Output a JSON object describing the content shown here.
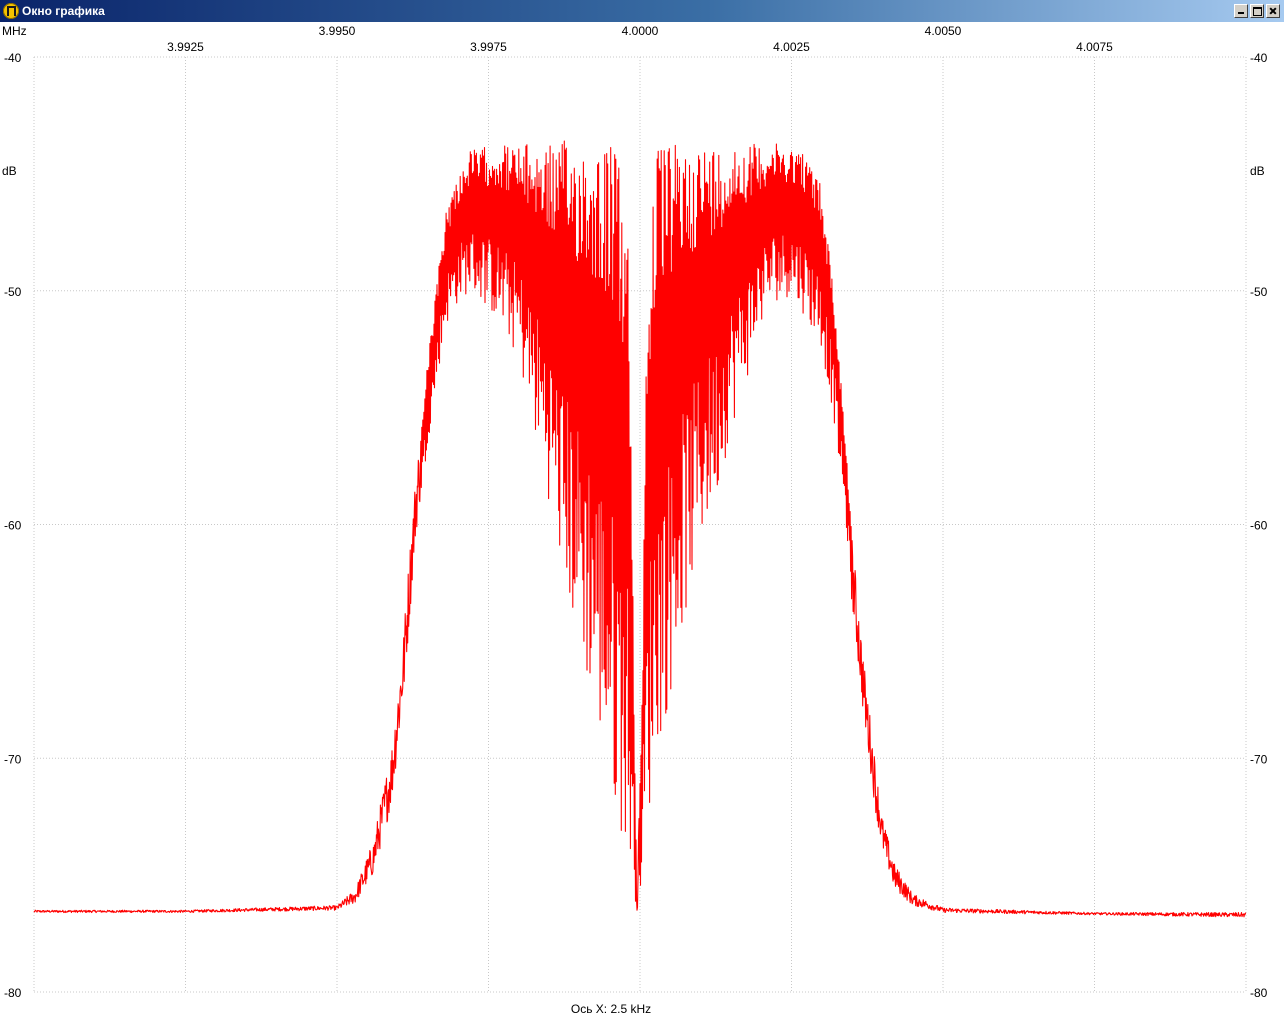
{
  "window": {
    "title": "Окно графика",
    "controls": [
      "minimize",
      "maximize",
      "close"
    ]
  },
  "colors": {
    "trace": "#ff0000",
    "grid": "#c8c8c8",
    "background": "#ffffff",
    "titlebar_start": "#0a246a",
    "titlebar_end": "#a6caf0"
  },
  "chart_data": {
    "type": "line",
    "title": "",
    "x_unit": "MHz",
    "y_unit": "dB",
    "xlim": [
      3.99,
      4.01
    ],
    "ylim": [
      -80,
      -40
    ],
    "x_ticks": [
      3.9925,
      3.995,
      3.9975,
      4.0,
      4.0025,
      4.005,
      4.0075
    ],
    "x_tick_labels_upper": [
      "3.9950",
      "4.0000",
      "4.0050"
    ],
    "x_tick_labels_lower": [
      "3.9925",
      "3.9975",
      "4.0025",
      "4.0075"
    ],
    "y_ticks": [
      -40,
      -50,
      -60,
      -70,
      -80
    ],
    "y_tick_labels": [
      "-40",
      "-50",
      "-60",
      "-70",
      "-80"
    ],
    "xlabel": "Ось X: 2.5 kHz",
    "grid": true,
    "series": [
      {
        "color": "#ff0000",
        "x": [
          3.99,
          3.9925,
          3.995,
          3.9953,
          3.9956,
          3.9959,
          3.9961,
          3.9962,
          3.9963,
          3.9965,
          3.9967,
          3.9968,
          3.997,
          3.9972,
          3.9975,
          3.9977,
          3.998,
          3.9982,
          3.9985,
          3.9987,
          3.999,
          3.9992,
          3.9994,
          3.9996,
          3.9998,
          3.99985,
          3.99995,
          4.00005,
          4.0001,
          4.0002,
          4.0003,
          4.0005,
          4.0007,
          4.001,
          4.0013,
          4.0015,
          4.0018,
          4.002,
          4.0022,
          4.0025,
          4.0027,
          4.003,
          4.0032,
          4.0034,
          4.0035,
          4.0037,
          4.0039,
          4.004,
          4.0042,
          4.0045,
          4.005,
          4.0075,
          4.01
        ],
        "envelope_top": [
          -76.5,
          -76.5,
          -76.3,
          -75.6,
          -73.5,
          -69.5,
          -64.5,
          -61.0,
          -57.8,
          -53.0,
          -48.5,
          -46.5,
          -45.0,
          -44.0,
          -43.8,
          -43.7,
          -43.8,
          -43.7,
          -43.7,
          -43.6,
          -43.5,
          -43.5,
          -43.5,
          -43.8,
          -47.0,
          -56.0,
          -76.5,
          -64.0,
          -52.0,
          -45.5,
          -43.8,
          -43.7,
          -43.7,
          -43.7,
          -43.8,
          -43.7,
          -43.7,
          -43.7,
          -43.7,
          -43.8,
          -44.0,
          -45.5,
          -50.0,
          -56.5,
          -60.5,
          -66.0,
          -70.5,
          -72.5,
          -74.5,
          -75.8,
          -76.4,
          -76.6,
          -76.6
        ],
        "envelope_bottom": [
          -76.6,
          -76.6,
          -76.5,
          -76.2,
          -75.0,
          -72.0,
          -67.5,
          -64.0,
          -60.5,
          -56.5,
          -53.0,
          -51.5,
          -50.5,
          -50.0,
          -50.8,
          -51.5,
          -53.0,
          -55.5,
          -59.0,
          -62.0,
          -65.5,
          -67.5,
          -70.0,
          -72.5,
          -74.0,
          -75.0,
          -76.5,
          -75.0,
          -74.0,
          -71.0,
          -69.5,
          -67.5,
          -64.5,
          -61.0,
          -58.5,
          -56.0,
          -53.5,
          -51.5,
          -50.5,
          -50.2,
          -51.0,
          -52.5,
          -55.5,
          -60.0,
          -63.5,
          -68.5,
          -72.5,
          -74.0,
          -75.6,
          -76.3,
          -76.6,
          -76.7,
          -76.8
        ]
      }
    ]
  }
}
